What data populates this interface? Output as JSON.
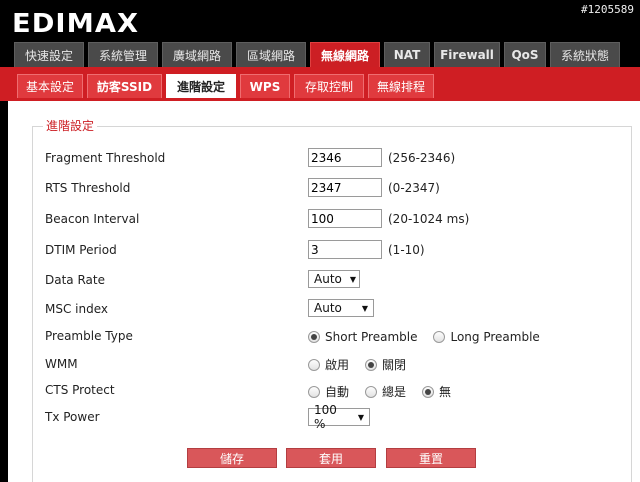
{
  "watermark": "#1205589",
  "brand": {
    "logo_text": "EDIMAX"
  },
  "main_tabs": [
    {
      "label": "快速設定",
      "w": 70
    },
    {
      "label": "系統管理",
      "w": 70
    },
    {
      "label": "廣域網路",
      "w": 70
    },
    {
      "label": "區域網路",
      "w": 70
    },
    {
      "label": "無線網路",
      "w": 70,
      "active": true
    },
    {
      "label": "NAT",
      "w": 46
    },
    {
      "label": "Firewall",
      "w": 66
    },
    {
      "label": "QoS",
      "w": 42
    },
    {
      "label": "系統狀態",
      "w": 70
    }
  ],
  "sub_tabs": [
    {
      "label": "基本設定",
      "w": 66
    },
    {
      "label": "訪客SSID",
      "w": 75
    },
    {
      "label": "進階設定",
      "w": 70,
      "active": true
    },
    {
      "label": "WPS",
      "w": 50
    },
    {
      "label": "存取控制",
      "w": 70
    },
    {
      "label": "無線排程",
      "w": 66
    }
  ],
  "section": {
    "title": "進階設定",
    "fragment": {
      "label": "Fragment Threshold",
      "value": "2346",
      "range": "(256-2346)"
    },
    "rts": {
      "label": "RTS Threshold",
      "value": "2347",
      "range": "(0-2347)"
    },
    "beacon": {
      "label": "Beacon Interval",
      "value": "100",
      "range": "(20-1024 ms)"
    },
    "dtim": {
      "label": "DTIM Period",
      "value": "3",
      "range": "(1-10)"
    },
    "data_rate": {
      "label": "Data Rate",
      "selected": "Auto"
    },
    "msc": {
      "label": "MSC index",
      "selected": "Auto"
    },
    "preamble": {
      "label": "Preamble Type",
      "options": [
        "Short Preamble",
        "Long Preamble"
      ],
      "checked": 0
    },
    "wmm": {
      "label": "WMM",
      "options": [
        "啟用",
        "關閉"
      ],
      "checked": 1
    },
    "cts": {
      "label": "CTS Protect",
      "options": [
        "自動",
        "總是",
        "無"
      ],
      "checked": 2
    },
    "tx_power": {
      "label": "Tx Power",
      "selected": "100 %"
    }
  },
  "buttons": {
    "save": "儲存",
    "apply": "套用",
    "reset": "重置"
  }
}
